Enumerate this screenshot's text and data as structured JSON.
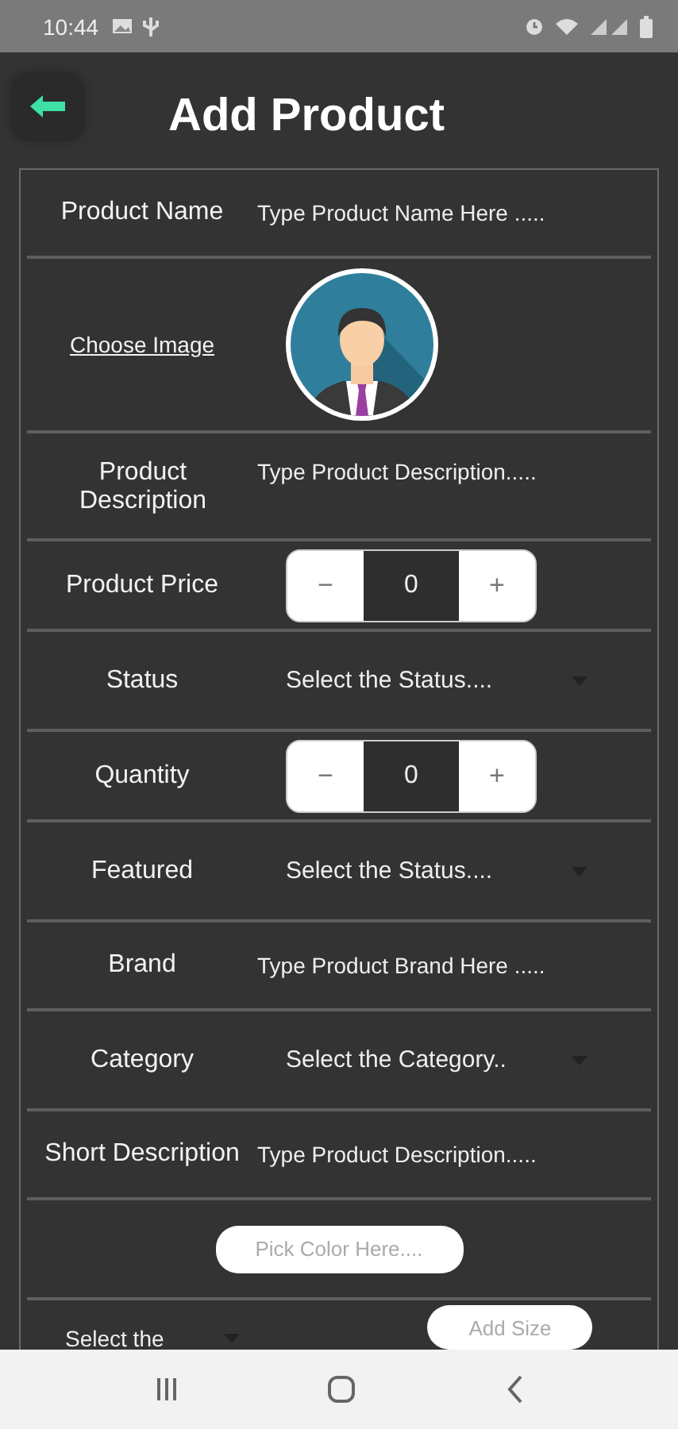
{
  "status_bar": {
    "time": "10:44"
  },
  "title": "Add Product",
  "form": {
    "rows": [
      {
        "kind": "input",
        "label": "Product Name",
        "placeholder": "Type Product Name Here ....."
      },
      {
        "kind": "image",
        "label": "Choose Image"
      },
      {
        "kind": "textarea",
        "label": "Product Description",
        "placeholder": "Type Product Description....."
      },
      {
        "kind": "stepper",
        "label": "Product Price",
        "minus": "−",
        "value": "0",
        "plus": "+"
      },
      {
        "kind": "dropdown",
        "label": "Status",
        "placeholder": "Select the Status...."
      },
      {
        "kind": "stepper",
        "label": "Quantity",
        "minus": "−",
        "value": "0",
        "plus": "+"
      },
      {
        "kind": "dropdown",
        "label": "Featured",
        "placeholder": "Select the Status...."
      },
      {
        "kind": "input",
        "label": "Brand",
        "placeholder": "Type Product Brand Here ....."
      },
      {
        "kind": "dropdown",
        "label": "Category",
        "placeholder": "Select the Category.."
      },
      {
        "kind": "input",
        "label": "Short Description",
        "placeholder": "Type Product Description....."
      },
      {
        "kind": "color",
        "button": "Pick Color Here...."
      },
      {
        "kind": "size",
        "placeholder": "Select the",
        "button": "Add Size"
      }
    ]
  }
}
